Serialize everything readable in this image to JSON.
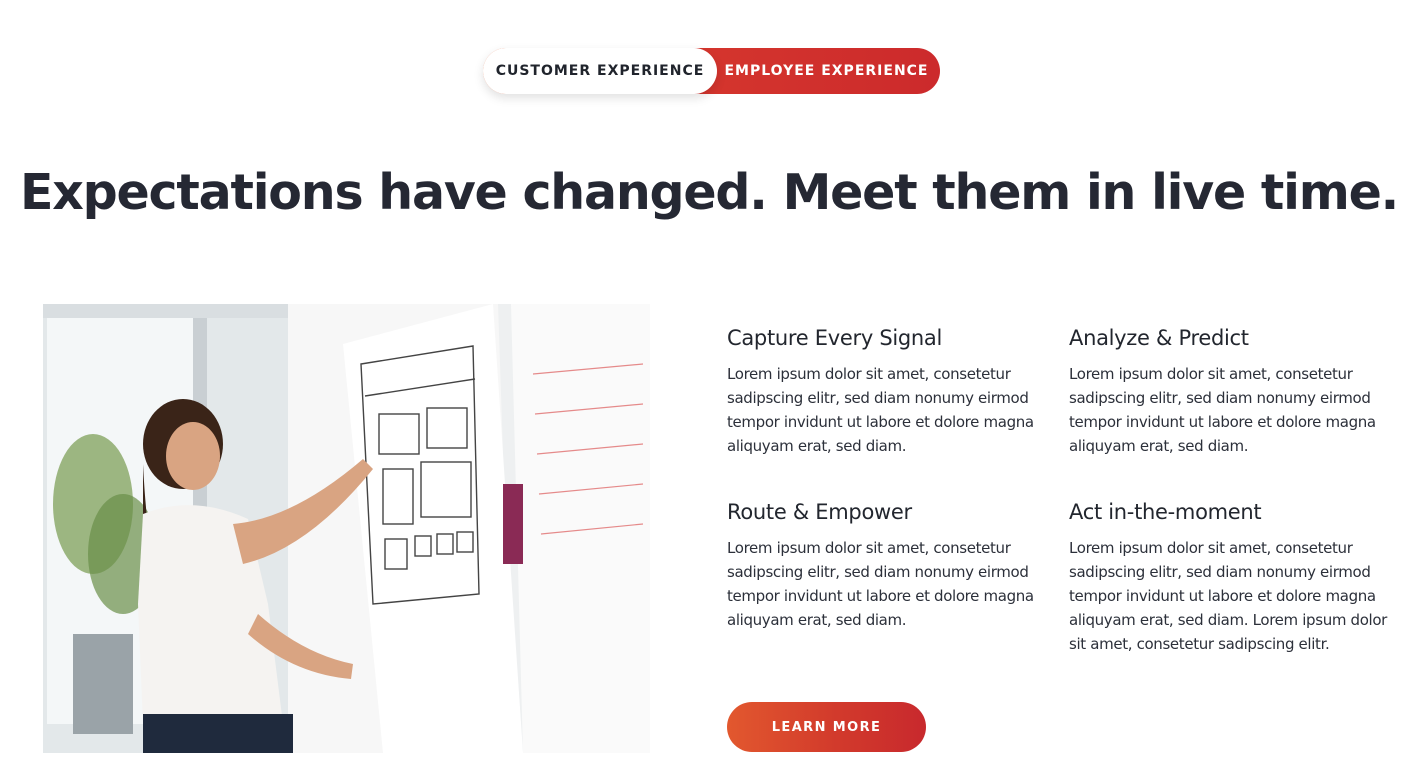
{
  "toggle": {
    "active_label": "CUSTOMER EXPERIENCE",
    "inactive_label": "EMPLOYEE EXPERIENCE"
  },
  "headline": "Expectations have changed. Meet them in live time.",
  "features": [
    {
      "title": "Capture Every Signal",
      "text": "Lorem ipsum dolor sit amet, consetetur sadipscing elitr, sed diam nonumy eirmod tempor invidunt ut labore et dolore magna aliquyam erat, sed diam."
    },
    {
      "title": "Analyze & Predict",
      "text": "Lorem ipsum dolor sit amet, consetetur sadipscing elitr, sed diam nonumy eirmod tempor invidunt ut labore et dolore magna aliquyam erat, sed diam."
    },
    {
      "title": "Route & Empower",
      "text": "Lorem ipsum dolor sit amet, consetetur sadipscing elitr, sed diam nonumy eirmod tempor invidunt ut labore et dolore magna aliquyam erat, sed diam."
    },
    {
      "title": "Act in-the-moment",
      "text": "Lorem ipsum dolor sit amet, consetetur sadipscing elitr, sed diam nonumy eirmod tempor invidunt ut labore et dolore magna aliquyam erat, sed diam. Lorem ipsum dolor sit amet, consetetur sadipscing elitr."
    }
  ],
  "cta": {
    "label": "LEARN MORE"
  },
  "colors": {
    "accent": "#cc2a2c",
    "accent_light": "#e2582e",
    "heading": "#252833",
    "body_text": "#2c303a"
  },
  "photo": {
    "subject": "woman-presenting-at-whiteboard"
  }
}
